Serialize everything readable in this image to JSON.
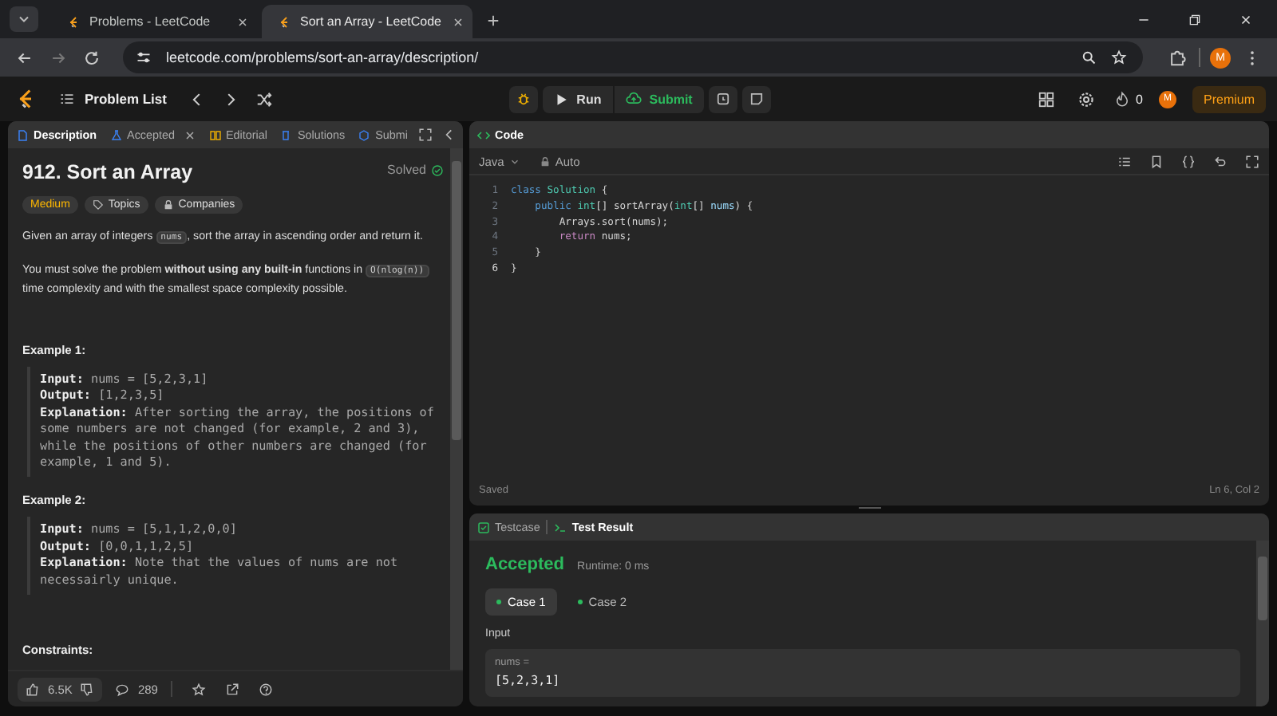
{
  "browser": {
    "tabs": [
      {
        "title": "Problems - LeetCode",
        "selected": false
      },
      {
        "title": "Sort an Array - LeetCode",
        "selected": true
      }
    ],
    "url": "leetcode.com/problems/sort-an-array/description/",
    "avatar": "M"
  },
  "topbar": {
    "problem_list": "Problem List",
    "run": "Run",
    "submit": "Submit",
    "streak": "0",
    "avatar": "M",
    "premium": "Premium"
  },
  "left": {
    "tabs": [
      {
        "label": "Description",
        "selected": true,
        "closable": false
      },
      {
        "label": "Accepted",
        "selected": false,
        "closable": true
      },
      {
        "label": "Editorial",
        "selected": false,
        "closable": false
      },
      {
        "label": "Solutions",
        "selected": false,
        "closable": false
      },
      {
        "label": "Submi",
        "selected": false,
        "closable": false
      }
    ],
    "title": "912. Sort an Array",
    "status": "Solved",
    "tags": [
      {
        "label": "Medium",
        "kind": "difficulty"
      },
      {
        "label": "Topics",
        "kind": "topics"
      },
      {
        "label": "Companies",
        "kind": "companies"
      }
    ],
    "paragraphs": [
      [
        {
          "kind": "text",
          "text": "Given an array of integers "
        },
        {
          "kind": "code",
          "text": "nums"
        },
        {
          "kind": "text",
          "text": ", sort the array in ascending order and return it."
        }
      ],
      [
        {
          "kind": "text",
          "text": "You must solve the problem **without using any built-in** functions in "
        },
        {
          "kind": "code",
          "text": "O(nlog(n))"
        },
        {
          "kind": "text",
          "text": " time complexity and with the smallest space complexity possible."
        }
      ]
    ],
    "examples": [
      {
        "title": "Example 1:",
        "lines": [
          {
            "label": "Input:",
            "value": "nums = [5,2,3,1]"
          },
          {
            "label": "Output:",
            "value": "[1,2,3,5]"
          },
          {
            "label": "Explanation:",
            "value": "After sorting the array, the positions of some numbers are not changed (for example, 2 and 3), while the positions of other numbers are changed (for example, 1 and 5)."
          }
        ]
      },
      {
        "title": "Example 2:",
        "lines": [
          {
            "label": "Input:",
            "value": "nums = [5,1,1,2,0,0]"
          },
          {
            "label": "Output:",
            "value": "[0,0,1,1,2,5]"
          },
          {
            "label": "Explanation:",
            "value": "Note that the values of nums are not necessairly unique."
          }
        ]
      }
    ],
    "constraints_title": "Constraints:",
    "likes": "6.5K",
    "comments": "289"
  },
  "code": {
    "title": "Code",
    "language": "Java",
    "mode": "Auto",
    "lines": [
      {
        "number": "1",
        "current": false,
        "tokens": [
          {
            "kind": "keyword",
            "text": "class "
          },
          {
            "kind": "type",
            "text": "Solution"
          },
          {
            "kind": "plain",
            "text": " {"
          }
        ]
      },
      {
        "number": "2",
        "current": false,
        "tokens": [
          {
            "kind": "keyword",
            "text": "    public "
          },
          {
            "kind": "type",
            "text": "int"
          },
          {
            "kind": "plain",
            "text": "[] sortArray("
          },
          {
            "kind": "type",
            "text": "int"
          },
          {
            "kind": "plain",
            "text": "[] "
          },
          {
            "kind": "param",
            "text": "nums"
          },
          {
            "kind": "plain",
            "text": ") {"
          }
        ]
      },
      {
        "number": "3",
        "current": false,
        "tokens": [
          {
            "kind": "plain",
            "text": "        Arrays.sort(nums);"
          }
        ]
      },
      {
        "number": "4",
        "current": false,
        "tokens": [
          {
            "kind": "control",
            "text": "        return "
          },
          {
            "kind": "plain",
            "text": "nums;"
          }
        ]
      },
      {
        "number": "5",
        "current": false,
        "tokens": [
          {
            "kind": "plain",
            "text": "    }"
          }
        ]
      },
      {
        "number": "6",
        "current": true,
        "tokens": [
          {
            "kind": "plain",
            "text": "}"
          }
        ]
      }
    ],
    "status": "Saved",
    "cursor": "Ln 6, Col 2"
  },
  "test": {
    "tabs": [
      {
        "label": "Testcase",
        "selected": false
      },
      {
        "label": "Test Result",
        "selected": true
      }
    ],
    "verdict": "Accepted",
    "runtime": "Runtime: 0 ms",
    "cases": [
      {
        "label": "Case 1",
        "selected": true
      },
      {
        "label": "Case 2",
        "selected": false
      }
    ],
    "input_label": "Input",
    "variable": "nums =",
    "value": "[5,2,3,1]"
  }
}
